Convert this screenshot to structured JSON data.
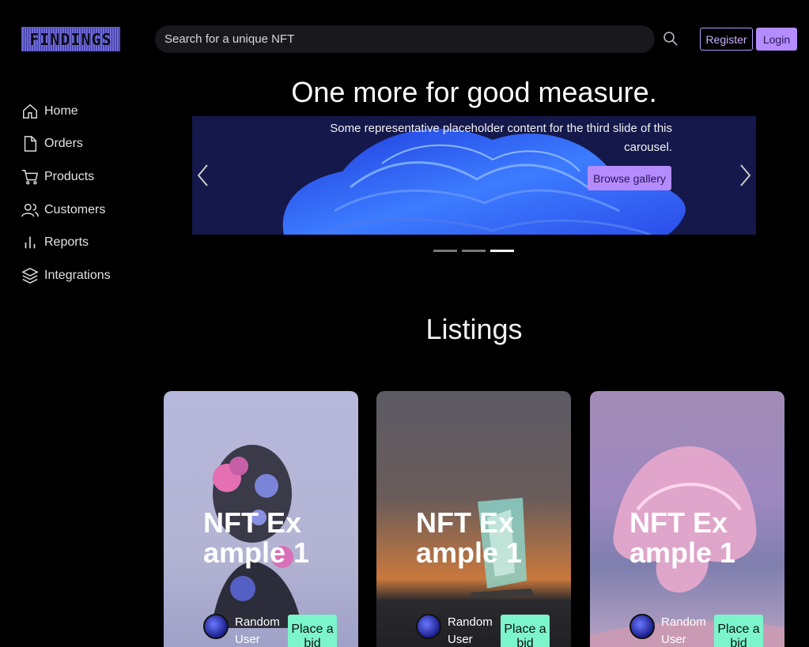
{
  "logo": {
    "text": "FINDINGS"
  },
  "search": {
    "placeholder": "Search for a unique NFT"
  },
  "auth": {
    "register": "Register",
    "login": "Login"
  },
  "sidebar": {
    "items": [
      {
        "label": "Home",
        "icon": "home-icon"
      },
      {
        "label": "Orders",
        "icon": "file-icon"
      },
      {
        "label": "Products",
        "icon": "cart-icon"
      },
      {
        "label": "Customers",
        "icon": "users-icon"
      },
      {
        "label": "Reports",
        "icon": "bar-chart-icon"
      },
      {
        "label": "Integrations",
        "icon": "layers-icon"
      }
    ]
  },
  "carousel": {
    "title": "One more for good measure.",
    "caption": "Some representative placeholder content for the third slide of this carousel.",
    "button": "Browse gallery",
    "active_index": 2,
    "slide_count": 3
  },
  "listings": {
    "title": "Listings",
    "cards": [
      {
        "title": "NFT Example 1",
        "user": "Random User",
        "button": "Place a bid"
      },
      {
        "title": "NFT Example 1",
        "user": "Random User",
        "button": "Place a bid"
      },
      {
        "title": "NFT Example 1",
        "user": "Random User",
        "button": "Place a bid"
      }
    ]
  },
  "colors": {
    "accent": "#b48cff",
    "bid": "#7cf5cc",
    "background": "#000000"
  }
}
